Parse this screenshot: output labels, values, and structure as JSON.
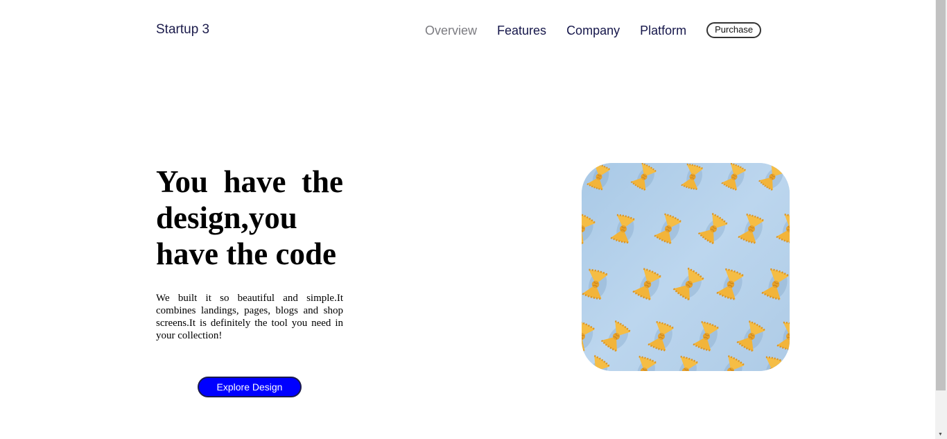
{
  "header": {
    "brand": "Startup 3",
    "nav": [
      {
        "label": "Overview",
        "active": true
      },
      {
        "label": "Features",
        "active": false
      },
      {
        "label": "Company",
        "active": false
      },
      {
        "label": "Platform",
        "active": false
      }
    ],
    "purchase_label": "Purchase"
  },
  "hero": {
    "title": "You have the design,you have the code",
    "description": "We built it so beautiful and simple.It combines landings, pages, blogs and shop screens.It is definitely the tool you need in your collection!",
    "cta_label": "Explore Design",
    "image_icon": "farfalle-pasta-pattern-image"
  },
  "colors": {
    "nav_text": "#15164a",
    "nav_active": "#7b7b80",
    "cta_background": "#0000ff",
    "image_background": "#b3d0ea",
    "pasta": "#f2b63d"
  }
}
